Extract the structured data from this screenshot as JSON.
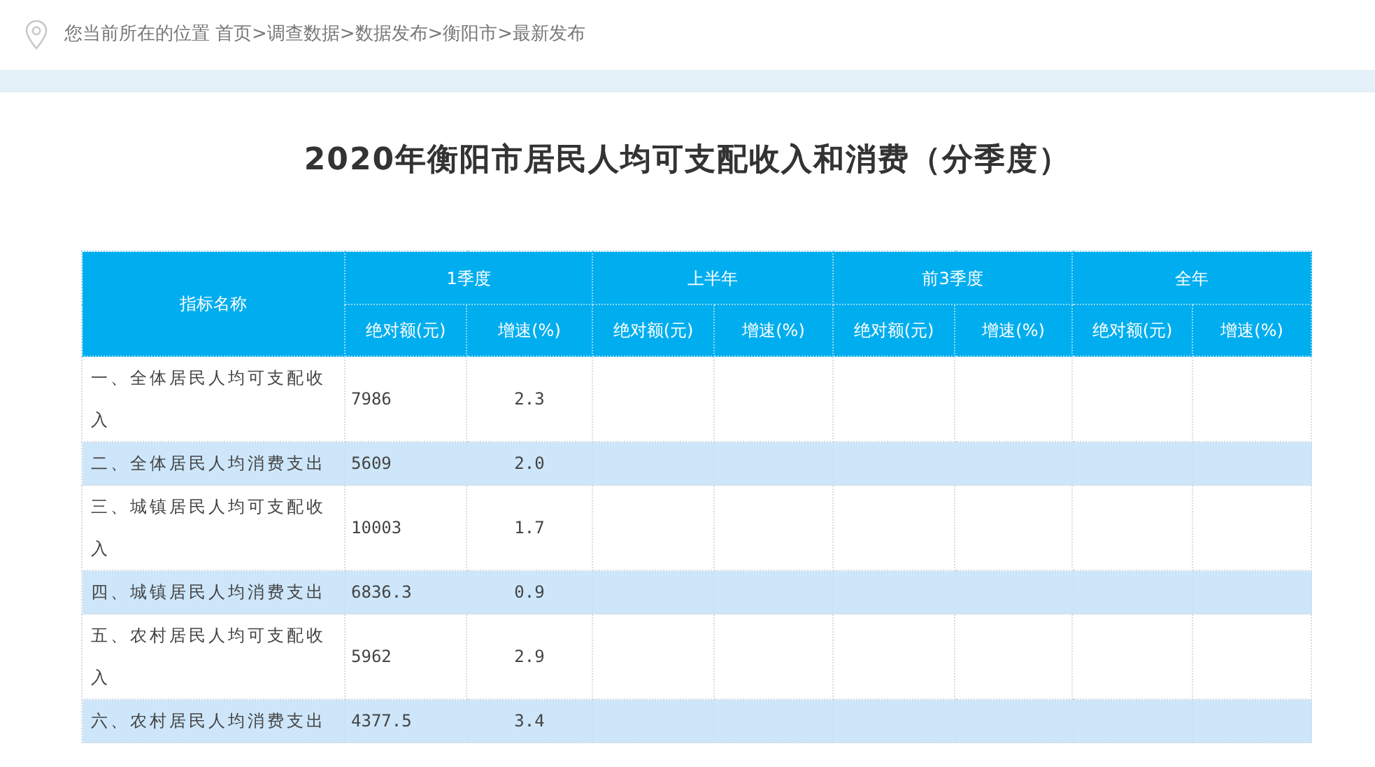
{
  "breadcrumb": {
    "prefix": "您当前所在的位置",
    "path": "首页>调查数据>数据发布>衡阳市>最新发布"
  },
  "title": "2020年衡阳市居民人均可支配收入和消费（分季度）",
  "table": {
    "name_header": "指标名称",
    "groups": [
      {
        "label": "1季度",
        "columns": [
          "绝对额(元)",
          "增速(%)"
        ]
      },
      {
        "label": "上半年",
        "columns": [
          "绝对额(元)",
          "增速(%)"
        ]
      },
      {
        "label": "前3季度",
        "columns": [
          "绝对额(元)",
          "增速(%)"
        ]
      },
      {
        "label": "全年",
        "columns": [
          "绝对额(元)",
          "增速(%)"
        ]
      }
    ],
    "rows": [
      {
        "name": "一、全体居民人均可支配收入",
        "values": [
          "7986",
          "2.3"
        ]
      },
      {
        "name": "二、全体居民人均消费支出",
        "values": [
          "5609",
          "2.0"
        ]
      },
      {
        "name": "三、城镇居民人均可支配收入",
        "values": [
          "10003",
          "1.7"
        ]
      },
      {
        "name": "四、城镇居民人均消费支出",
        "values": [
          "6836.3",
          "0.9"
        ]
      },
      {
        "name": "五、农村居民人均可支配收入",
        "values": [
          "5962",
          "2.9"
        ]
      },
      {
        "name": "六、农村居民人均消费支出",
        "values": [
          "4377.5",
          "3.4"
        ]
      }
    ]
  }
}
